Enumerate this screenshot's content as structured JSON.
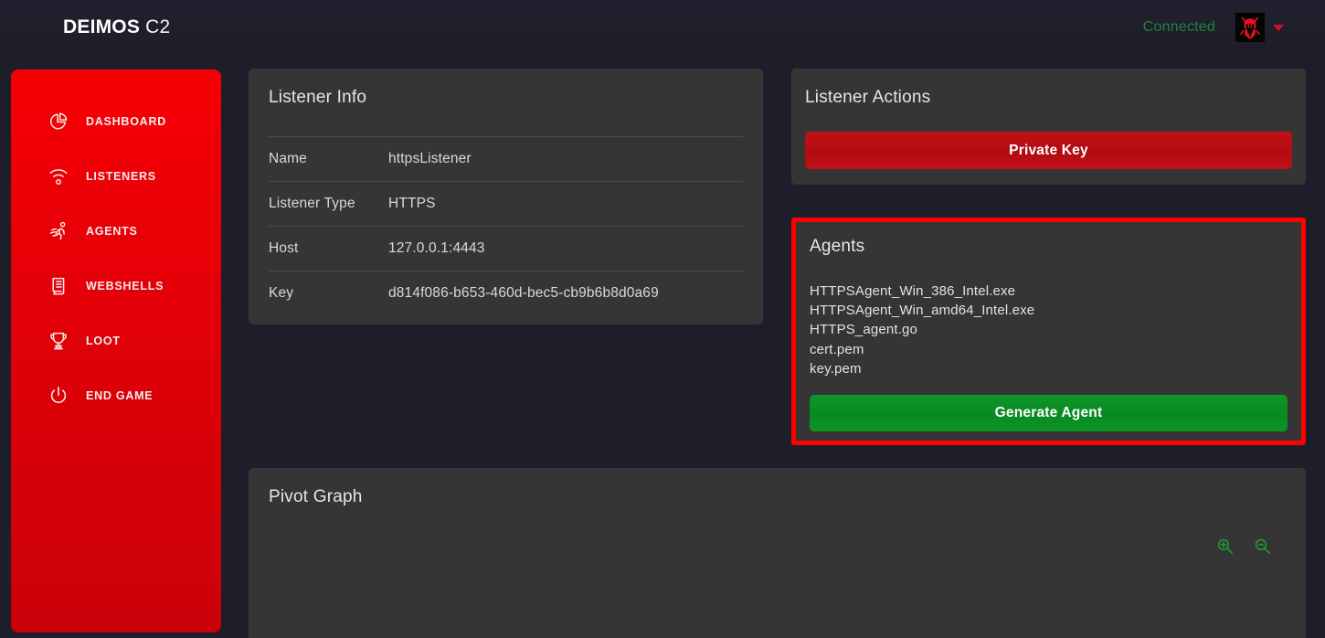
{
  "navbar": {
    "brand_bold": "DEIMOS",
    "brand_light": "C2",
    "connection_status": "Connected",
    "avatar_icon": "spartan-helmet-icon",
    "dropdown_icon": "caret-down-icon",
    "status_color": "#21823a"
  },
  "sidebar": {
    "items": [
      {
        "label": "DASHBOARD",
        "icon": "pie-chart-icon"
      },
      {
        "label": "LISTENERS",
        "icon": "broadcast-signal-icon"
      },
      {
        "label": "AGENTS",
        "icon": "running-person-icon"
      },
      {
        "label": "WEBSHELLS",
        "icon": "scroll-document-icon"
      },
      {
        "label": "LOOT",
        "icon": "trophy-icon"
      },
      {
        "label": "END GAME",
        "icon": "power-icon"
      }
    ],
    "accent_color": "#ee0006"
  },
  "listener_info": {
    "title": "Listener Info",
    "rows": [
      {
        "key": "Name",
        "value": "httpsListener"
      },
      {
        "key": "Listener Type",
        "value": "HTTPS"
      },
      {
        "key": "Host",
        "value": "127.0.0.1:4443"
      },
      {
        "key": "Key",
        "value": "d814f086-b653-460d-bec5-cb9b6b8d0a69"
      }
    ]
  },
  "listener_actions": {
    "title": "Listener Actions",
    "private_key_label": "Private Key",
    "button_color": "#b80d14"
  },
  "agents": {
    "title": "Agents",
    "highlight_color": "#ff0000",
    "files": [
      "HTTPSAgent_Win_386_Intel.exe",
      "HTTPSAgent_Win_amd64_Intel.exe",
      "HTTPS_agent.go",
      "cert.pem",
      "key.pem"
    ],
    "generate_label": "Generate Agent",
    "generate_color": "#0a8e23"
  },
  "pivot_graph": {
    "title": "Pivot Graph",
    "zoom_in_icon": "zoom-in-icon",
    "zoom_out_icon": "zoom-out-icon",
    "zoom_icon_color": "#1f9c30"
  }
}
